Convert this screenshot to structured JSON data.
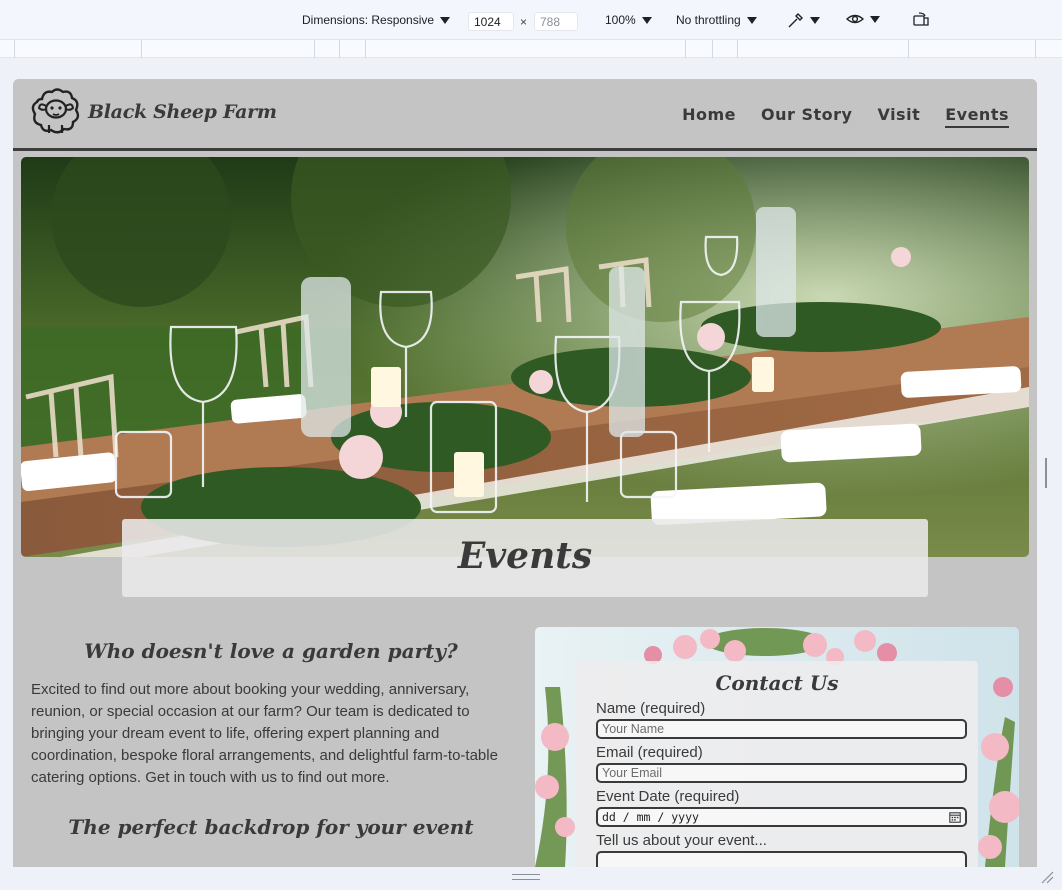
{
  "devtools": {
    "dimensions_label": "Dimensions: Responsive",
    "width_value": "1024",
    "times": "×",
    "height_placeholder": "788",
    "zoom": "100%",
    "throttling": "No throttling"
  },
  "site": {
    "brand": "Black Sheep Farm",
    "nav": [
      {
        "label": "Home"
      },
      {
        "label": "Our Story"
      },
      {
        "label": "Visit"
      },
      {
        "label": "Events"
      }
    ]
  },
  "hero": {
    "title": "Events"
  },
  "content": {
    "heading1": "Who doesn't love a garden party?",
    "paragraph": "Excited to find out more about booking your wedding, anniversary, reunion, or special occasion at our farm? Our team is dedicated to bringing your dream event to life, offering expert planning and coordination, bespoke floral arrangements, and delightful farm-to-table catering options. Get in touch with us to find out more.",
    "heading2": "The perfect backdrop for your event"
  },
  "form": {
    "title": "Contact Us",
    "name_label": "Name (required)",
    "name_placeholder": "Your Name",
    "email_label": "Email (required)",
    "email_placeholder": "Your Email",
    "date_label": "Event Date (required)",
    "date_placeholder": "dd / mm / yyyy",
    "message_label": "Tell us about your event..."
  }
}
